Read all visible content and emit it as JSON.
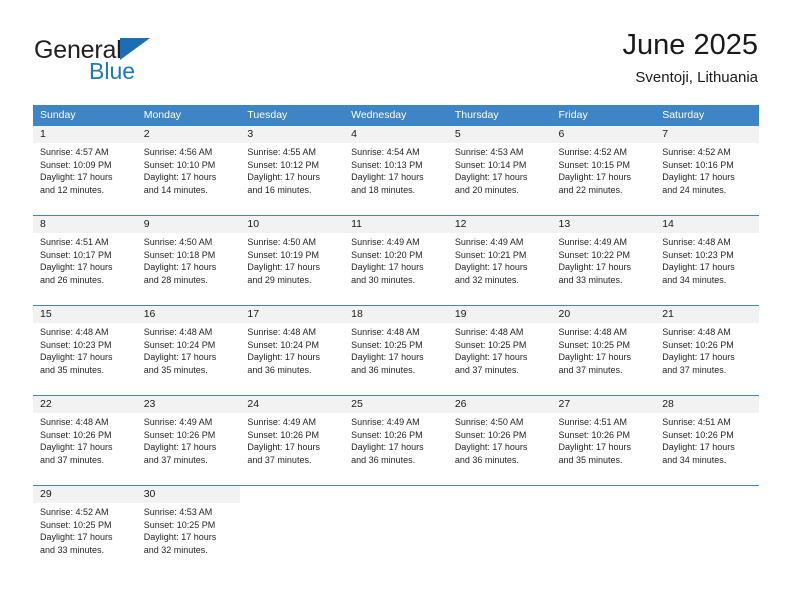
{
  "brand": {
    "name_part1": "General",
    "name_part2": "Blue",
    "accent_color": "#1c6eb4"
  },
  "header": {
    "title": "June 2025",
    "subtitle": "Sventoji, Lithuania"
  },
  "calendar": {
    "header_color": "#3d85c6",
    "day_strip_color": "#f2f2f2",
    "weekdays": [
      "Sunday",
      "Monday",
      "Tuesday",
      "Wednesday",
      "Thursday",
      "Friday",
      "Saturday"
    ],
    "weeks": [
      [
        {
          "day": "1",
          "sunrise": "Sunrise: 4:57 AM",
          "sunset": "Sunset: 10:09 PM",
          "daylight_line1": "Daylight: 17 hours",
          "daylight_line2": "and 12 minutes."
        },
        {
          "day": "2",
          "sunrise": "Sunrise: 4:56 AM",
          "sunset": "Sunset: 10:10 PM",
          "daylight_line1": "Daylight: 17 hours",
          "daylight_line2": "and 14 minutes."
        },
        {
          "day": "3",
          "sunrise": "Sunrise: 4:55 AM",
          "sunset": "Sunset: 10:12 PM",
          "daylight_line1": "Daylight: 17 hours",
          "daylight_line2": "and 16 minutes."
        },
        {
          "day": "4",
          "sunrise": "Sunrise: 4:54 AM",
          "sunset": "Sunset: 10:13 PM",
          "daylight_line1": "Daylight: 17 hours",
          "daylight_line2": "and 18 minutes."
        },
        {
          "day": "5",
          "sunrise": "Sunrise: 4:53 AM",
          "sunset": "Sunset: 10:14 PM",
          "daylight_line1": "Daylight: 17 hours",
          "daylight_line2": "and 20 minutes."
        },
        {
          "day": "6",
          "sunrise": "Sunrise: 4:52 AM",
          "sunset": "Sunset: 10:15 PM",
          "daylight_line1": "Daylight: 17 hours",
          "daylight_line2": "and 22 minutes."
        },
        {
          "day": "7",
          "sunrise": "Sunrise: 4:52 AM",
          "sunset": "Sunset: 10:16 PM",
          "daylight_line1": "Daylight: 17 hours",
          "daylight_line2": "and 24 minutes."
        }
      ],
      [
        {
          "day": "8",
          "sunrise": "Sunrise: 4:51 AM",
          "sunset": "Sunset: 10:17 PM",
          "daylight_line1": "Daylight: 17 hours",
          "daylight_line2": "and 26 minutes."
        },
        {
          "day": "9",
          "sunrise": "Sunrise: 4:50 AM",
          "sunset": "Sunset: 10:18 PM",
          "daylight_line1": "Daylight: 17 hours",
          "daylight_line2": "and 28 minutes."
        },
        {
          "day": "10",
          "sunrise": "Sunrise: 4:50 AM",
          "sunset": "Sunset: 10:19 PM",
          "daylight_line1": "Daylight: 17 hours",
          "daylight_line2": "and 29 minutes."
        },
        {
          "day": "11",
          "sunrise": "Sunrise: 4:49 AM",
          "sunset": "Sunset: 10:20 PM",
          "daylight_line1": "Daylight: 17 hours",
          "daylight_line2": "and 30 minutes."
        },
        {
          "day": "12",
          "sunrise": "Sunrise: 4:49 AM",
          "sunset": "Sunset: 10:21 PM",
          "daylight_line1": "Daylight: 17 hours",
          "daylight_line2": "and 32 minutes."
        },
        {
          "day": "13",
          "sunrise": "Sunrise: 4:49 AM",
          "sunset": "Sunset: 10:22 PM",
          "daylight_line1": "Daylight: 17 hours",
          "daylight_line2": "and 33 minutes."
        },
        {
          "day": "14",
          "sunrise": "Sunrise: 4:48 AM",
          "sunset": "Sunset: 10:23 PM",
          "daylight_line1": "Daylight: 17 hours",
          "daylight_line2": "and 34 minutes."
        }
      ],
      [
        {
          "day": "15",
          "sunrise": "Sunrise: 4:48 AM",
          "sunset": "Sunset: 10:23 PM",
          "daylight_line1": "Daylight: 17 hours",
          "daylight_line2": "and 35 minutes."
        },
        {
          "day": "16",
          "sunrise": "Sunrise: 4:48 AM",
          "sunset": "Sunset: 10:24 PM",
          "daylight_line1": "Daylight: 17 hours",
          "daylight_line2": "and 35 minutes."
        },
        {
          "day": "17",
          "sunrise": "Sunrise: 4:48 AM",
          "sunset": "Sunset: 10:24 PM",
          "daylight_line1": "Daylight: 17 hours",
          "daylight_line2": "and 36 minutes."
        },
        {
          "day": "18",
          "sunrise": "Sunrise: 4:48 AM",
          "sunset": "Sunset: 10:25 PM",
          "daylight_line1": "Daylight: 17 hours",
          "daylight_line2": "and 36 minutes."
        },
        {
          "day": "19",
          "sunrise": "Sunrise: 4:48 AM",
          "sunset": "Sunset: 10:25 PM",
          "daylight_line1": "Daylight: 17 hours",
          "daylight_line2": "and 37 minutes."
        },
        {
          "day": "20",
          "sunrise": "Sunrise: 4:48 AM",
          "sunset": "Sunset: 10:25 PM",
          "daylight_line1": "Daylight: 17 hours",
          "daylight_line2": "and 37 minutes."
        },
        {
          "day": "21",
          "sunrise": "Sunrise: 4:48 AM",
          "sunset": "Sunset: 10:26 PM",
          "daylight_line1": "Daylight: 17 hours",
          "daylight_line2": "and 37 minutes."
        }
      ],
      [
        {
          "day": "22",
          "sunrise": "Sunrise: 4:48 AM",
          "sunset": "Sunset: 10:26 PM",
          "daylight_line1": "Daylight: 17 hours",
          "daylight_line2": "and 37 minutes."
        },
        {
          "day": "23",
          "sunrise": "Sunrise: 4:49 AM",
          "sunset": "Sunset: 10:26 PM",
          "daylight_line1": "Daylight: 17 hours",
          "daylight_line2": "and 37 minutes."
        },
        {
          "day": "24",
          "sunrise": "Sunrise: 4:49 AM",
          "sunset": "Sunset: 10:26 PM",
          "daylight_line1": "Daylight: 17 hours",
          "daylight_line2": "and 37 minutes."
        },
        {
          "day": "25",
          "sunrise": "Sunrise: 4:49 AM",
          "sunset": "Sunset: 10:26 PM",
          "daylight_line1": "Daylight: 17 hours",
          "daylight_line2": "and 36 minutes."
        },
        {
          "day": "26",
          "sunrise": "Sunrise: 4:50 AM",
          "sunset": "Sunset: 10:26 PM",
          "daylight_line1": "Daylight: 17 hours",
          "daylight_line2": "and 36 minutes."
        },
        {
          "day": "27",
          "sunrise": "Sunrise: 4:51 AM",
          "sunset": "Sunset: 10:26 PM",
          "daylight_line1": "Daylight: 17 hours",
          "daylight_line2": "and 35 minutes."
        },
        {
          "day": "28",
          "sunrise": "Sunrise: 4:51 AM",
          "sunset": "Sunset: 10:26 PM",
          "daylight_line1": "Daylight: 17 hours",
          "daylight_line2": "and 34 minutes."
        }
      ],
      [
        {
          "day": "29",
          "sunrise": "Sunrise: 4:52 AM",
          "sunset": "Sunset: 10:25 PM",
          "daylight_line1": "Daylight: 17 hours",
          "daylight_line2": "and 33 minutes."
        },
        {
          "day": "30",
          "sunrise": "Sunrise: 4:53 AM",
          "sunset": "Sunset: 10:25 PM",
          "daylight_line1": "Daylight: 17 hours",
          "daylight_line2": "and 32 minutes."
        },
        {
          "day": "",
          "sunrise": "",
          "sunset": "",
          "daylight_line1": "",
          "daylight_line2": ""
        },
        {
          "day": "",
          "sunrise": "",
          "sunset": "",
          "daylight_line1": "",
          "daylight_line2": ""
        },
        {
          "day": "",
          "sunrise": "",
          "sunset": "",
          "daylight_line1": "",
          "daylight_line2": ""
        },
        {
          "day": "",
          "sunrise": "",
          "sunset": "",
          "daylight_line1": "",
          "daylight_line2": ""
        },
        {
          "day": "",
          "sunrise": "",
          "sunset": "",
          "daylight_line1": "",
          "daylight_line2": ""
        }
      ]
    ]
  }
}
